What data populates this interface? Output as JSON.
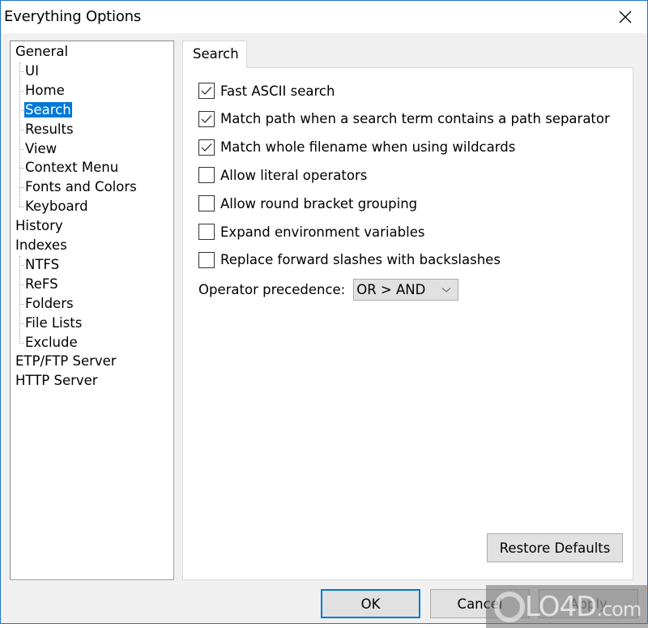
{
  "window": {
    "title": "Everything Options",
    "close_icon": "close-icon"
  },
  "tree": {
    "items": [
      {
        "label": "General",
        "level": 0
      },
      {
        "label": "UI",
        "level": 1
      },
      {
        "label": "Home",
        "level": 1
      },
      {
        "label": "Search",
        "level": 1,
        "selected": true
      },
      {
        "label": "Results",
        "level": 1
      },
      {
        "label": "View",
        "level": 1
      },
      {
        "label": "Context Menu",
        "level": 1
      },
      {
        "label": "Fonts and Colors",
        "level": 1
      },
      {
        "label": "Keyboard",
        "level": 1
      },
      {
        "label": "History",
        "level": 0
      },
      {
        "label": "Indexes",
        "level": 0
      },
      {
        "label": "NTFS",
        "level": 1
      },
      {
        "label": "ReFS",
        "level": 1
      },
      {
        "label": "Folders",
        "level": 1
      },
      {
        "label": "File Lists",
        "level": 1
      },
      {
        "label": "Exclude",
        "level": 1
      },
      {
        "label": "ETP/FTP Server",
        "level": 0
      },
      {
        "label": "HTTP Server",
        "level": 0
      }
    ]
  },
  "tab": {
    "label": "Search"
  },
  "options": [
    {
      "label": "Fast ASCII search",
      "checked": true
    },
    {
      "label": "Match path when a search term contains a path separator",
      "checked": true
    },
    {
      "label": "Match whole filename when using wildcards",
      "checked": true
    },
    {
      "label": "Allow literal operators",
      "checked": false
    },
    {
      "label": "Allow round bracket grouping",
      "checked": false
    },
    {
      "label": "Expand environment variables",
      "checked": false
    },
    {
      "label": "Replace forward slashes with backslashes",
      "checked": false
    }
  ],
  "precedence": {
    "label": "Operator precedence:",
    "value": "OR > AND"
  },
  "buttons": {
    "restore_defaults": "Restore Defaults",
    "ok": "OK",
    "cancel": "Cancel",
    "apply": "Apply"
  },
  "watermark": {
    "text": "LO4D",
    "suffix": ".com"
  }
}
